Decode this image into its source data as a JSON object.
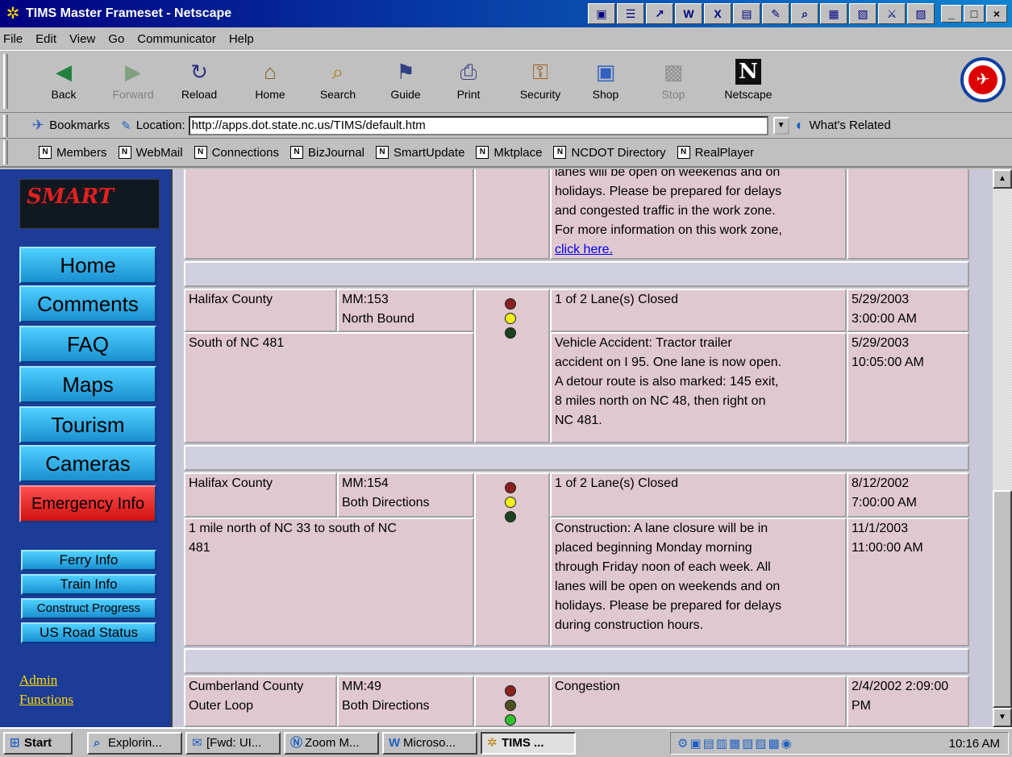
{
  "window": {
    "title": "TIMS Master Frameset - Netscape",
    "controls": [
      "_",
      "□",
      "×"
    ],
    "quicklaunch": [
      "▣",
      "☰",
      "↗",
      "W",
      "X",
      "▤",
      "✎",
      "⌕",
      "▦",
      "▧",
      "⚔",
      "▨"
    ]
  },
  "menu": [
    "File",
    "Edit",
    "View",
    "Go",
    "Communicator",
    "Help"
  ],
  "toolbar": {
    "buttons": [
      {
        "label": "Back",
        "icon": "back-arrow-icon",
        "glyph": "◀",
        "enabled": true
      },
      {
        "label": "Forward",
        "icon": "forward-arrow-icon",
        "glyph": "▶",
        "enabled": false
      },
      {
        "label": "Reload",
        "icon": "reload-icon",
        "glyph": "↻",
        "enabled": true
      },
      {
        "label": "Home",
        "icon": "home-icon",
        "glyph": "⌂",
        "enabled": true
      },
      {
        "label": "Search",
        "icon": "search-icon",
        "glyph": "⌕",
        "enabled": true
      },
      {
        "label": "Guide",
        "icon": "guide-icon",
        "glyph": "⚑",
        "enabled": true
      },
      {
        "label": "Print",
        "icon": "print-icon",
        "glyph": "⎙",
        "enabled": true
      },
      {
        "label": "Security",
        "icon": "lock-icon",
        "glyph": "⚿",
        "enabled": true
      },
      {
        "label": "Shop",
        "icon": "shop-icon",
        "glyph": "▣",
        "enabled": true
      },
      {
        "label": "Stop",
        "icon": "stop-icon",
        "glyph": "▩",
        "enabled": false
      },
      {
        "label": "Netscape",
        "icon": "netscape-n-icon",
        "glyph": "N",
        "enabled": true
      }
    ]
  },
  "location": {
    "bookmarks_label": "Bookmarks",
    "location_label": "Location:",
    "url": "http://apps.dot.state.nc.us/TIMS/default.htm",
    "related_label": "What's Related"
  },
  "personal_toolbar": [
    "Members",
    "WebMail",
    "Connections",
    "BizJournal",
    "SmartUpdate",
    "Mktplace",
    "NCDOT Directory",
    "RealPlayer"
  ],
  "sidebar": {
    "logo_text": "SMART",
    "nav": [
      "Home",
      "Comments",
      "FAQ",
      "Maps",
      "Tourism",
      "Cameras",
      "Emergency Info"
    ],
    "subnav": [
      "Ferry Info",
      "Train Info",
      "Construct Progress",
      "US Road Status"
    ],
    "admin": [
      "Admin",
      "Functions"
    ]
  },
  "content": {
    "top_fragment": {
      "line1": "lanes will be open on weekends and on",
      "line2": "holidays. Please be prepared for delays",
      "line3": "and congested traffic in the work zone.",
      "line4": "For more information on this work zone,",
      "link": "click here."
    },
    "incidents": [
      {
        "county": "Halifax County",
        "mm": "MM:153",
        "direction": "North Bound",
        "location": "South of NC 481",
        "status": "1 of 2 Lane(s) Closed",
        "start_date": "5/29/2003",
        "start_time": "3:00:00 AM",
        "description_lines": [
          "Vehicle Accident: Tractor trailer",
          "accident on I 95. One lane is now open.",
          "A detour route is also marked: 145 exit,",
          "8 miles north on NC 48, then right on",
          "NC 481."
        ],
        "end_date": "5/29/2003",
        "end_time": "10:05:00 AM"
      },
      {
        "county": "Halifax County",
        "mm": "MM:154",
        "direction": "Both Directions",
        "location_lines": [
          "1 mile north of NC 33 to south of NC",
          "481"
        ],
        "status": "1 of 2 Lane(s) Closed",
        "start_date": "8/12/2002",
        "start_time": "7:00:00 AM",
        "description_lines": [
          "Construction: A lane closure will be in",
          "placed beginning Monday morning",
          "through Friday noon of each week. All",
          "lanes will be open on weekends and on",
          "holidays. Please be prepared for delays",
          "during construction hours."
        ],
        "end_date": "11/1/2003",
        "end_time": "11:00:00 AM"
      },
      {
        "county": "Cumberland County",
        "county2": "Outer Loop",
        "mm": "MM:49",
        "direction": "Both Directions",
        "status": "Congestion",
        "start_date": "2/4/2002 2:09:00",
        "start_time": "PM"
      }
    ]
  },
  "taskbar": {
    "start": "Start",
    "tasks": [
      "Explorin...",
      "[Fwd: UI...",
      "Zoom M...",
      "Microso...",
      "TIMS ..."
    ],
    "tray_icons": "⚙▣▤▥▦▧▨▩◉",
    "clock": "10:16 AM"
  },
  "colors": {
    "sidebar_bg": "#1c3c98",
    "nav_button": "#4fd0ff",
    "emergency": "#ff3030",
    "cell_bg": "#e0c8d0",
    "link": "#0000ee",
    "admin_link": "#ffd700"
  }
}
